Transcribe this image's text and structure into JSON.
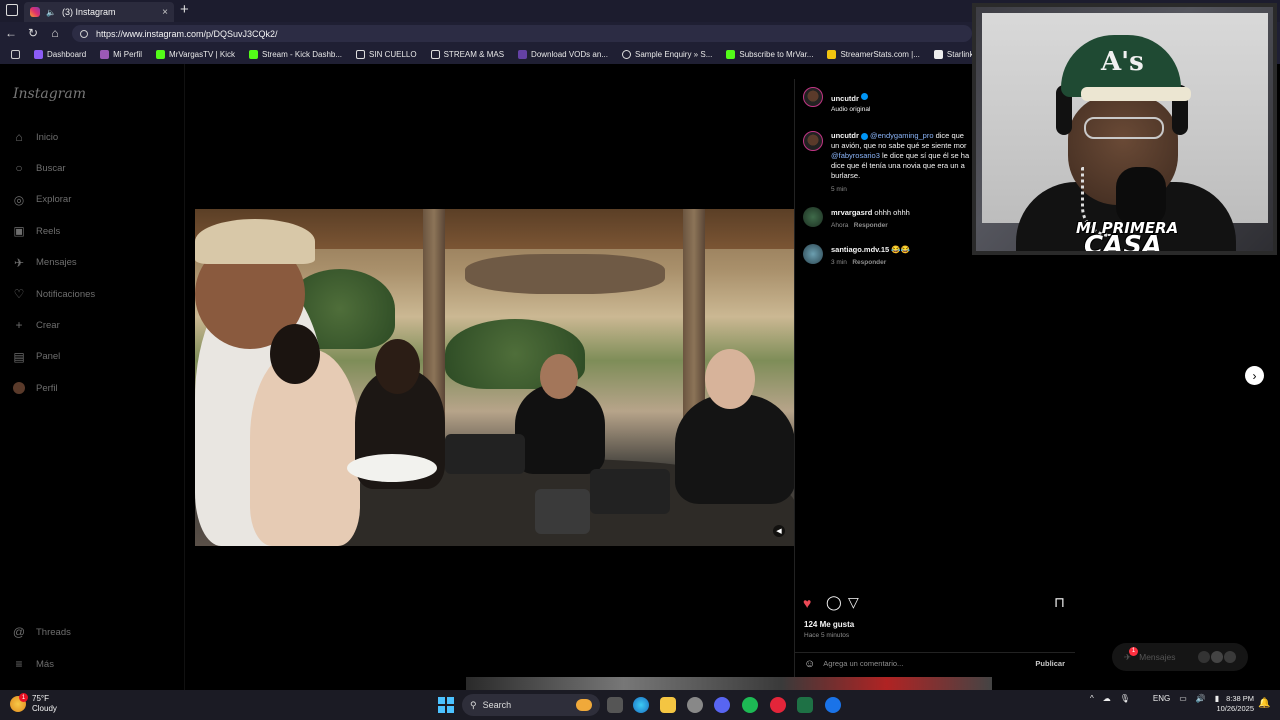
{
  "browser": {
    "tab_title": "(3) Instagram",
    "tab_close": "×",
    "new_tab": "+",
    "url": "https://www.instagram.com/p/DQSuvJ3CQk2/",
    "bookmarks": [
      {
        "label": "Dashboard",
        "color": "#8b5cf6"
      },
      {
        "label": "Mi Perfil",
        "color": "#9b59b6"
      },
      {
        "label": "MrVargasTV | Kick",
        "color": "#53fc18"
      },
      {
        "label": "Stream - Kick Dashb...",
        "color": "#53fc18"
      },
      {
        "label": "SIN CUELLO",
        "color": "folder"
      },
      {
        "label": "STREAM & MAS",
        "color": "folder"
      },
      {
        "label": "Download VODs an...",
        "color": "#6441a5"
      },
      {
        "label": "Sample Enquiry » S...",
        "color": "globe"
      },
      {
        "label": "Subscribe to MrVar...",
        "color": "#53fc18"
      },
      {
        "label": "StreamerStats.com |...",
        "color": "#f1c40f"
      },
      {
        "label": "Starlink Battery Pow...",
        "color": "#eeeeee"
      }
    ]
  },
  "instagram": {
    "logo": "Instagram",
    "nav": [
      {
        "label": "Inicio",
        "icon": "home-icon",
        "glyph": "⌂"
      },
      {
        "label": "Buscar",
        "icon": "search-icon",
        "glyph": "○"
      },
      {
        "label": "Explorar",
        "icon": "compass-icon",
        "glyph": "◎"
      },
      {
        "label": "Reels",
        "icon": "reels-icon",
        "glyph": "▣"
      },
      {
        "label": "Mensajes",
        "icon": "messages-icon",
        "glyph": "✈"
      },
      {
        "label": "Notificaciones",
        "icon": "heart-icon",
        "glyph": "♡"
      },
      {
        "label": "Crear",
        "icon": "plus-icon",
        "glyph": "+"
      },
      {
        "label": "Panel",
        "icon": "chart-icon",
        "glyph": "▤"
      },
      {
        "label": "Perfil",
        "icon": "profile-icon",
        "glyph": "●"
      }
    ],
    "nav_bottom": [
      {
        "label": "Threads",
        "icon": "threads-icon",
        "glyph": "@"
      },
      {
        "label": "Más",
        "icon": "menu-icon",
        "glyph": "≡"
      }
    ],
    "post": {
      "author": "uncutdr",
      "audio": "Audio original",
      "caption_author": "uncutdr",
      "caption_mention1": "@endygaming_pro",
      "caption_part1": " dice que",
      "caption_line2": "un avión, que no sabe qué se siente mor",
      "caption_mention2": "@fabyrosario3",
      "caption_part2": " le dice que sí que él se ha",
      "caption_line4": "dice que él tenía una novia que era un a",
      "caption_line5": "burlarse.",
      "caption_time": "5 min",
      "comments": [
        {
          "user": "mrvargasrd",
          "text": "ohhh ohhh",
          "time": "Ahora",
          "reply": "Responder"
        },
        {
          "user": "santiago.mdv.15",
          "text": "😂😂",
          "time": "3 min",
          "reply": "Responder"
        }
      ],
      "likes": "124 Me gusta",
      "posted": "Hace 5 minutos",
      "comment_placeholder": "Agrega un comentario...",
      "publish": "Publicar"
    },
    "messages_pill": "Mensajes",
    "messages_badge": "1"
  },
  "webcam": {
    "overlay_line1": "MI PRIMERA",
    "overlay_line2": "CASA",
    "cap_logo": "A's"
  },
  "taskbar": {
    "temperature": "75°F",
    "weather": "Cloudy",
    "weather_badge": "1",
    "search": "Search",
    "language": "ENG",
    "time": "8:38 PM",
    "date": "10/26/2025"
  },
  "colors": {
    "like_red": "#ed4956",
    "verified_blue": "#0095f6",
    "mention_blue": "#8ab4f8"
  }
}
